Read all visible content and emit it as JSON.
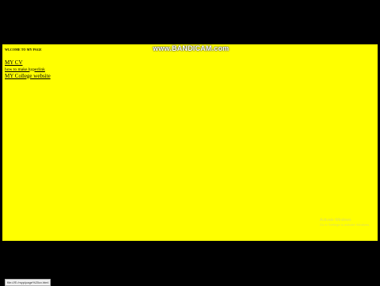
{
  "page": {
    "heading": "WLCOME TO MY PAGE",
    "links": [
      {
        "label": "MY CV"
      },
      {
        "label": "how to make hyperlink"
      },
      {
        "label": "MY College website"
      }
    ]
  },
  "watermark": {
    "prefix": "www.",
    "brand": "BANDICAM",
    "suffix": ".com"
  },
  "activation": {
    "line1": "Activate Windows",
    "line2": "Go to Settings to activate Windows."
  },
  "status_bar": {
    "url": "file:///E:/myp/page%20cv.html"
  },
  "colors": {
    "page_background": "#ffff00",
    "letterbox": "#000000",
    "text": "#000000"
  }
}
